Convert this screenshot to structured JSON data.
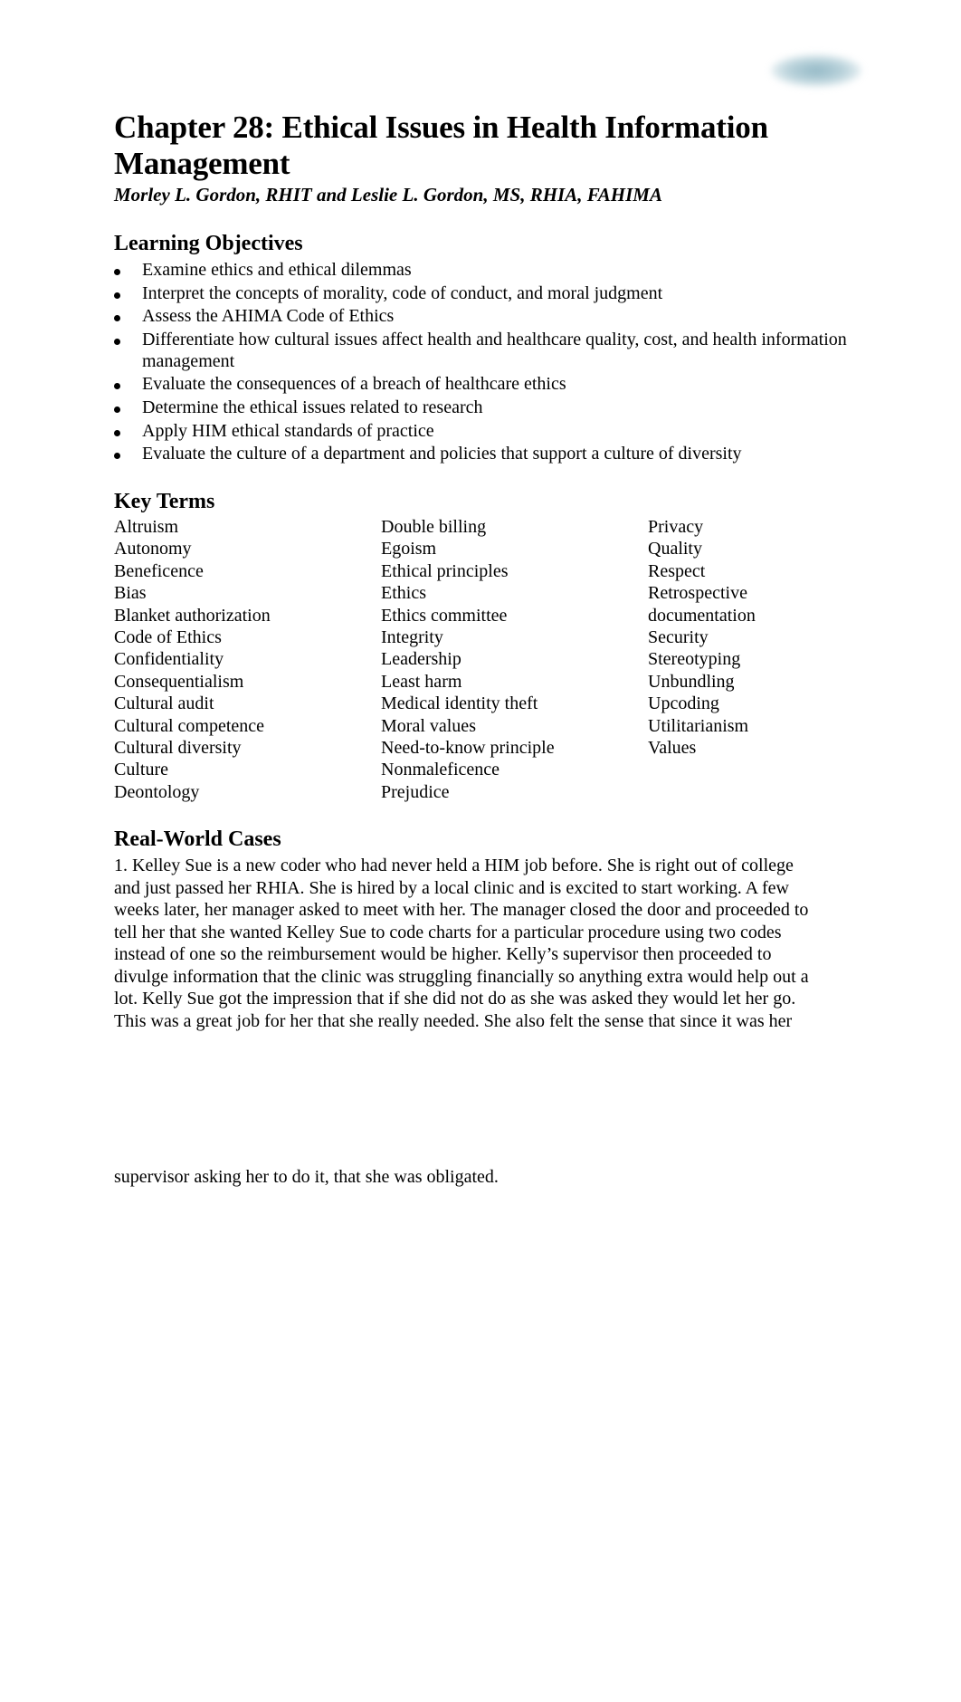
{
  "logo": {
    "icon": "blurred-logo"
  },
  "title": {
    "line1": "Chapter 28: Ethical Issues in Health Information",
    "line2": "Management"
  },
  "authors": "Morley L. Gordon, RHIT and Leslie L. Gordon, MS, RHIA, FAHIMA",
  "learning_objectives": {
    "heading": "Learning Objectives",
    "items": [
      "Examine ethics and ethical dilemmas",
      "Interpret the concepts of morality, code of conduct, and moral judgment",
      "Assess the AHIMA Code of Ethics",
      "Differentiate how cultural issues affect health and healthcare quality, cost, and health information management",
      "Evaluate the consequences of a breach of healthcare ethics",
      "Determine the ethical issues related to research",
      "Apply HIM ethical standards of practice",
      "Evaluate the culture of a department and policies that support a culture of diversity"
    ]
  },
  "key_terms": {
    "heading": "Key Terms",
    "columns": [
      [
        "Altruism",
        "Autonomy",
        "Beneficence",
        "Bias",
        "Blanket authorization",
        "Code of Ethics",
        "Confidentiality",
        "Consequentialism",
        "Cultural audit",
        "Cultural competence",
        "Cultural diversity",
        "Culture",
        "Deontology"
      ],
      [
        "Double billing",
        "Egoism",
        "Ethical principles",
        "Ethics",
        "Ethics committee",
        "Integrity",
        "Leadership",
        "Least harm",
        "Medical identity theft",
        "Moral values",
        "Need-to-know principle",
        "Nonmaleficence",
        "Prejudice"
      ],
      [
        "Privacy",
        "Quality",
        "Respect",
        "Retrospective",
        "documentation",
        "Security",
        "Stereotyping",
        "Unbundling",
        "Upcoding",
        "Utilitarianism",
        "Values"
      ]
    ]
  },
  "real_world_cases": {
    "heading": "Real-World Cases",
    "case1_lines": [
      "1. Kelley Sue is a new coder who had never held a HIM job before. She is right out of college",
      "and just passed her RHIA. She is hired by a local clinic and is excited to start working. A few",
      "weeks later, her manager asked to meet with her. The manager closed the door and proceeded to",
      "tell her that she wanted Kelley Sue to code charts for a particular procedure using two codes",
      "instead of one so the reimbursement would be higher. Kelly’s supervisor then proceeded to",
      "divulge information that the clinic was struggling financially so anything extra would help out a",
      "lot. Kelly Sue got the impression that if she did not do as she was asked they would let her go.",
      "This was a great job for her that she really needed. She also felt the sense that since it was her",
      "supervisor asking her to do it, that she was obligated."
    ]
  }
}
